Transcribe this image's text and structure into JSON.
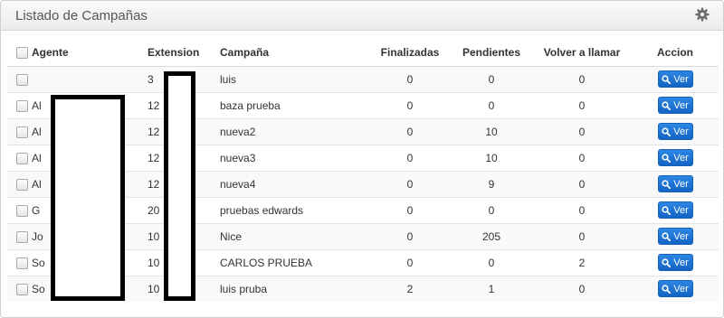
{
  "panel": {
    "title": "Listado de Campañas",
    "icon": "gear-icon"
  },
  "table": {
    "headers": {
      "agente": "Agente",
      "extension": "Extension",
      "campana": "Campaña",
      "finalizadas": "Finalizadas",
      "pendientes": "Pendientes",
      "volver": "Volver a llamar",
      "accion": "Accion"
    },
    "button_label": "Ver",
    "button_icon": "search-icon",
    "rows": [
      {
        "agente": "",
        "extension": "3",
        "campana": "luis",
        "finalizadas": "0",
        "pendientes": "0",
        "volver": "0"
      },
      {
        "agente": "Al",
        "extension": "12",
        "campana": "baza prueba",
        "finalizadas": "0",
        "pendientes": "0",
        "volver": "0"
      },
      {
        "agente": "Al",
        "extension": "12",
        "campana": "nueva2",
        "finalizadas": "0",
        "pendientes": "10",
        "volver": "0"
      },
      {
        "agente": "Al",
        "extension": "12",
        "campana": "nueva3",
        "finalizadas": "0",
        "pendientes": "10",
        "volver": "0"
      },
      {
        "agente": "Al",
        "extension": "12",
        "campana": "nueva4",
        "finalizadas": "0",
        "pendientes": "9",
        "volver": "0"
      },
      {
        "agente": "G",
        "extension": "20",
        "campana": "pruebas edwards",
        "finalizadas": "0",
        "pendientes": "0",
        "volver": "0"
      },
      {
        "agente": "Jo",
        "extension": "10",
        "campana": "Nice",
        "finalizadas": "0",
        "pendientes": "205",
        "volver": "0"
      },
      {
        "agente": "So",
        "extension": "10",
        "campana": "CARLOS PRUEBA",
        "finalizadas": "0",
        "pendientes": "0",
        "volver": "2"
      },
      {
        "agente": "So",
        "extension": "10",
        "campana": "luis pruba",
        "finalizadas": "2",
        "pendientes": "1",
        "volver": "0"
      }
    ]
  },
  "colors": {
    "button": "#1a6fd0",
    "redaction": "#000000"
  }
}
